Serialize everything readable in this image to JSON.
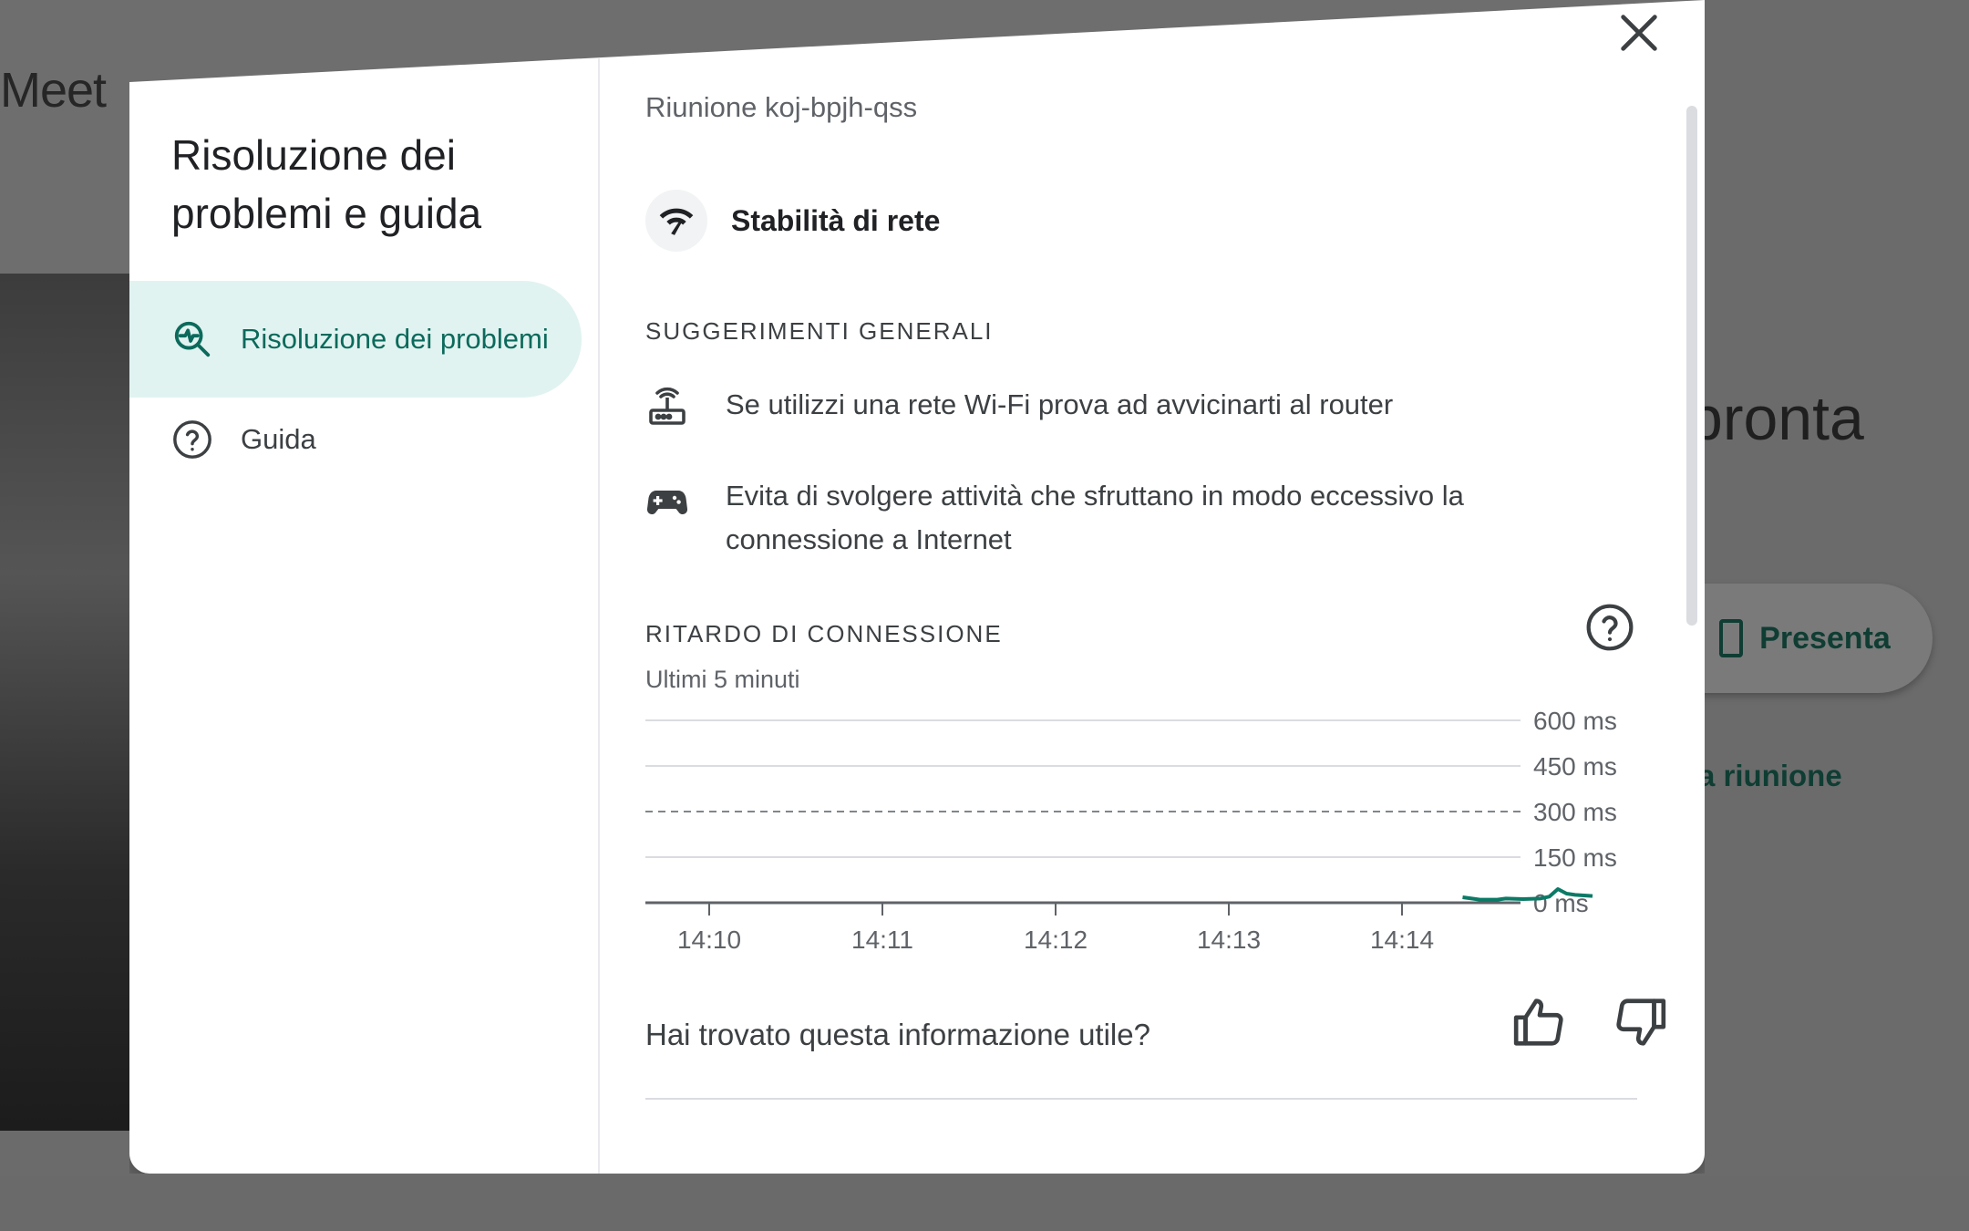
{
  "background": {
    "app_name": "Meet",
    "ready_text": "pronta",
    "present_label": "Presenta",
    "other_meeting_text": "ta riunione"
  },
  "dialog": {
    "title": "Risoluzione dei problemi e guida",
    "nav": [
      {
        "label": "Risoluzione dei problemi",
        "icon": "troubleshoot-icon",
        "active": true
      },
      {
        "label": "Guida",
        "icon": "help-icon",
        "active": false
      }
    ],
    "meeting_id": "Riunione koj-bpjh-qss",
    "section_title": "Stabilità di rete",
    "tips_label": "SUGGERIMENTI GENERALI",
    "tips": [
      {
        "icon": "router-icon",
        "text": "Se utilizzi una rete Wi-Fi prova ad avvicinarti al router"
      },
      {
        "icon": "gamepad-icon",
        "text": "Evita di svolgere attività che sfruttano in modo eccessivo la connessione a Internet"
      }
    ],
    "delay_label": "RITARDO DI CONNESSIONE",
    "delay_sub": "Ultimi 5 minuti",
    "feedback_question": "Hai trovato questa informazione utile?",
    "accent": "#0b6a5b",
    "active_bg": "#e1f3f1"
  },
  "chart_data": {
    "type": "line",
    "y_ticks": [
      "600 ms",
      "450 ms",
      "300 ms",
      "150 ms",
      "0 ms"
    ],
    "ylim": [
      0,
      600
    ],
    "x_ticks": [
      "14:10",
      "14:11",
      "14:12",
      "14:13",
      "14:14"
    ],
    "threshold": 300,
    "series": [
      {
        "color": "#0b7a66",
        "x": [
          4.35,
          4.45,
          4.55,
          4.6,
          4.7,
          4.8,
          4.85,
          4.9,
          4.95,
          5.0,
          5.1
        ],
        "y": [
          18,
          10,
          10,
          14,
          12,
          14,
          20,
          45,
          30,
          26,
          22
        ]
      }
    ]
  }
}
